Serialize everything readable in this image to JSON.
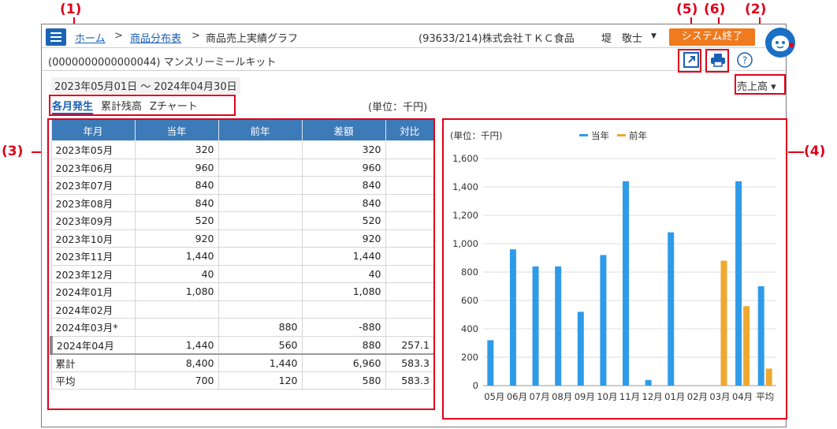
{
  "annotations": {
    "n1": "(1)",
    "n2": "(2)",
    "n3": "(3)",
    "n4": "(4)",
    "n5": "(5)",
    "n6": "(6)",
    "color": "#e0001b"
  },
  "header": {
    "breadcrumb": [
      {
        "label": "ホーム",
        "link": true
      },
      {
        "label": "商品分布表",
        "link": true
      },
      {
        "label": "商品売上実績グラフ",
        "link": false
      }
    ],
    "separator": ">",
    "company": "(93633/214)株式会社ＴＫＣ食品",
    "user": "堤　敬士",
    "logout_label": "システム終了",
    "icons": [
      "menu-icon",
      "chevron-down-icon",
      "assistant-avatar-icon"
    ]
  },
  "subheader": {
    "product": "(0000000000000044) マンスリーミールキット",
    "icons": [
      "external-link-icon",
      "print-icon",
      "help-icon"
    ]
  },
  "controls": {
    "period": "2023年05月01日 ～ 2024年04月30日",
    "tabs": [
      {
        "label": "各月発生",
        "active": true
      },
      {
        "label": "累計残高",
        "active": false
      },
      {
        "label": "Zチャート",
        "active": false
      }
    ],
    "unit": "(単位：千円)",
    "metric": "売上高",
    "metric_caret": "▾"
  },
  "table": {
    "headers": [
      "年月",
      "当年",
      "前年",
      "差額",
      "対比"
    ],
    "rows": [
      [
        "2023年05月",
        "320",
        "",
        "320",
        ""
      ],
      [
        "2023年06月",
        "960",
        "",
        "960",
        ""
      ],
      [
        "2023年07月",
        "840",
        "",
        "840",
        ""
      ],
      [
        "2023年08月",
        "840",
        "",
        "840",
        ""
      ],
      [
        "2023年09月",
        "520",
        "",
        "520",
        ""
      ],
      [
        "2023年10月",
        "920",
        "",
        "920",
        ""
      ],
      [
        "2023年11月",
        "1,440",
        "",
        "1,440",
        ""
      ],
      [
        "2023年12月",
        "40",
        "",
        "40",
        ""
      ],
      [
        "2024年01月",
        "1,080",
        "",
        "1,080",
        ""
      ],
      [
        "2024年02月",
        "",
        "",
        "",
        ""
      ],
      [
        "2024年03月*",
        "",
        "880",
        "-880",
        ""
      ],
      [
        "2024年04月",
        "1,440",
        "560",
        "880",
        "257.1"
      ]
    ],
    "summary": [
      [
        "累計",
        "8,400",
        "1,440",
        "6,960",
        "583.3"
      ],
      [
        "平均",
        "700",
        "120",
        "580",
        "583.3"
      ]
    ],
    "header_color": "#3d7ab8"
  },
  "chart_data": {
    "type": "bar",
    "unit_label": "(単位：千円)",
    "categories": [
      "05月",
      "06月",
      "07月",
      "08月",
      "09月",
      "10月",
      "11月",
      "12月",
      "01月",
      "02月",
      "03月",
      "04月",
      "平均"
    ],
    "series": [
      {
        "name": "当年",
        "color": "#2f9be8",
        "values": [
          320,
          960,
          840,
          840,
          520,
          920,
          1440,
          40,
          1080,
          0,
          0,
          1440,
          700
        ]
      },
      {
        "name": "前年",
        "color": "#f0a830",
        "values": [
          0,
          0,
          0,
          0,
          0,
          0,
          0,
          0,
          0,
          0,
          880,
          560,
          120
        ]
      }
    ],
    "ylim": [
      0,
      1600
    ],
    "yticks": [
      0,
      200,
      400,
      600,
      800,
      1000,
      1200,
      1400,
      1600
    ],
    "ytick_labels": [
      "0",
      "200",
      "400",
      "600",
      "800",
      "1,000",
      "1,200",
      "1,400",
      "1,600"
    ],
    "grid": true,
    "legend": "top"
  }
}
